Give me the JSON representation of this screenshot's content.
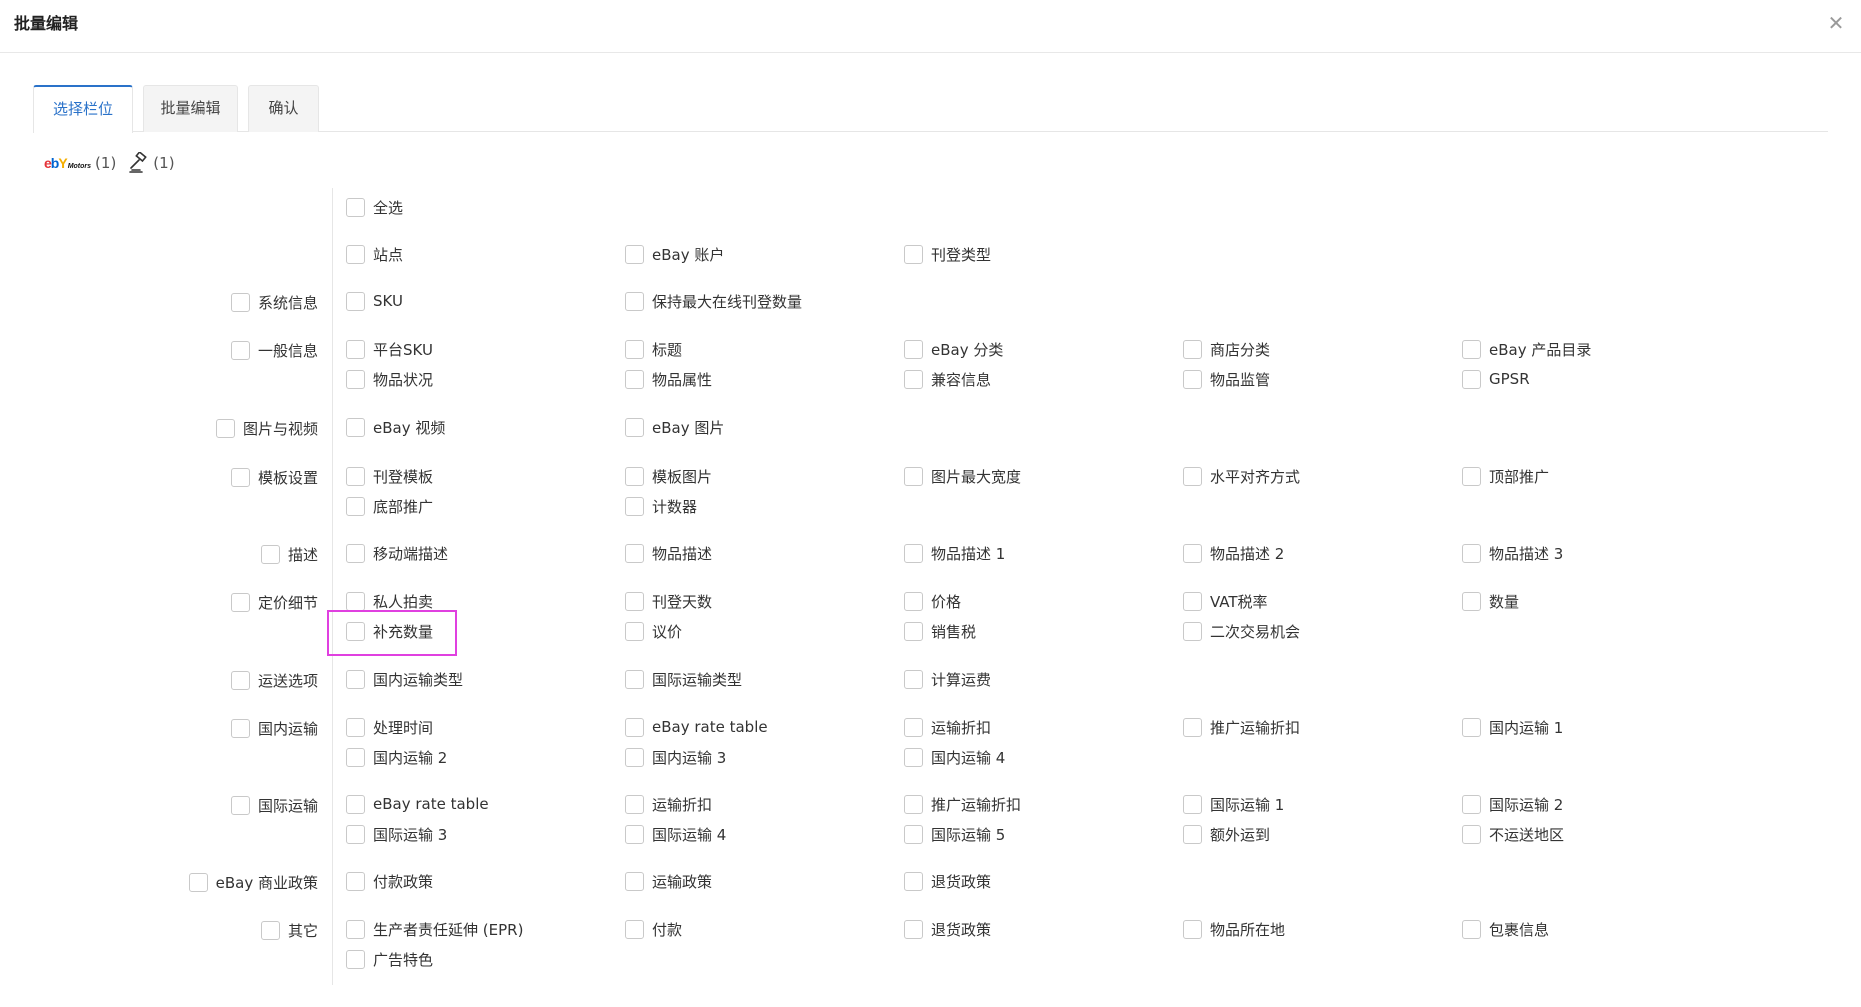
{
  "dialog": {
    "title": "批量编辑",
    "close_icon": "close-x-icon"
  },
  "tabs": [
    {
      "label": "选择栏位",
      "active": true
    },
    {
      "label": "批量编辑",
      "active": false
    },
    {
      "label": "确认",
      "active": false
    }
  ],
  "platforms": {
    "ebay_motors_logo": {
      "e": "e",
      "b": "b",
      "a": "a",
      "y": "Y",
      "motors": "Motors"
    },
    "ebay_count": "(1)",
    "auction_icon": "gavel-icon",
    "auction_count": "(1)"
  },
  "select_all": "全选",
  "top_row": [
    "站点",
    "eBay 账户",
    "刊登类型"
  ],
  "categories": [
    {
      "label": "系统信息",
      "fields": [
        [
          "SKU",
          "保持最大在线刊登数量"
        ]
      ]
    },
    {
      "label": "一般信息",
      "fields": [
        [
          "平台SKU",
          "标题",
          "eBay 分类",
          "商店分类",
          "eBay 产品目录"
        ],
        [
          "物品状况",
          "物品属性",
          "兼容信息",
          "物品监管",
          "GPSR"
        ]
      ]
    },
    {
      "label": "图片与视频",
      "fields": [
        [
          "eBay 视频",
          "eBay 图片"
        ]
      ]
    },
    {
      "label": "模板设置",
      "fields": [
        [
          "刊登模板",
          "模板图片",
          "图片最大宽度",
          "水平对齐方式",
          "顶部推广"
        ],
        [
          "底部推广",
          "计数器"
        ]
      ]
    },
    {
      "label": "描述",
      "fields": [
        [
          "移动端描述",
          "物品描述",
          "物品描述 1",
          "物品描述 2",
          "物品描述 3"
        ]
      ]
    },
    {
      "label": "定价细节",
      "fields": [
        [
          "私人拍卖",
          "刊登天数",
          "价格",
          "VAT税率",
          "数量"
        ],
        [
          "补充数量",
          "议价",
          "销售税",
          "二次交易机会"
        ]
      ]
    },
    {
      "label": "运送选项",
      "fields": [
        [
          "国内运输类型",
          "国际运输类型",
          "计算运费"
        ]
      ]
    },
    {
      "label": "国内运输",
      "fields": [
        [
          "处理时间",
          "eBay rate table",
          "运输折扣",
          "推广运输折扣",
          "国内运输 1"
        ],
        [
          "国内运输 2",
          "国内运输 3",
          "国内运输 4"
        ]
      ]
    },
    {
      "label": "国际运输",
      "fields": [
        [
          "eBay rate table",
          "运输折扣",
          "推广运输折扣",
          "国际运输 1",
          "国际运输 2"
        ],
        [
          "国际运输 3",
          "国际运输 4",
          "国际运输 5",
          "额外运到",
          "不运送地区"
        ]
      ]
    },
    {
      "label": "eBay 商业政策",
      "fields": [
        [
          "付款政策",
          "运输政策",
          "退货政策"
        ]
      ]
    },
    {
      "label": "其它",
      "fields": [
        [
          "生产者责任延伸 (EPR)",
          "付款",
          "退货政策",
          "物品所在地",
          "包裹信息"
        ],
        [
          "广告特色"
        ]
      ]
    }
  ],
  "colors": {
    "accent": "#2a72c9",
    "highlight": "#e040e0"
  }
}
